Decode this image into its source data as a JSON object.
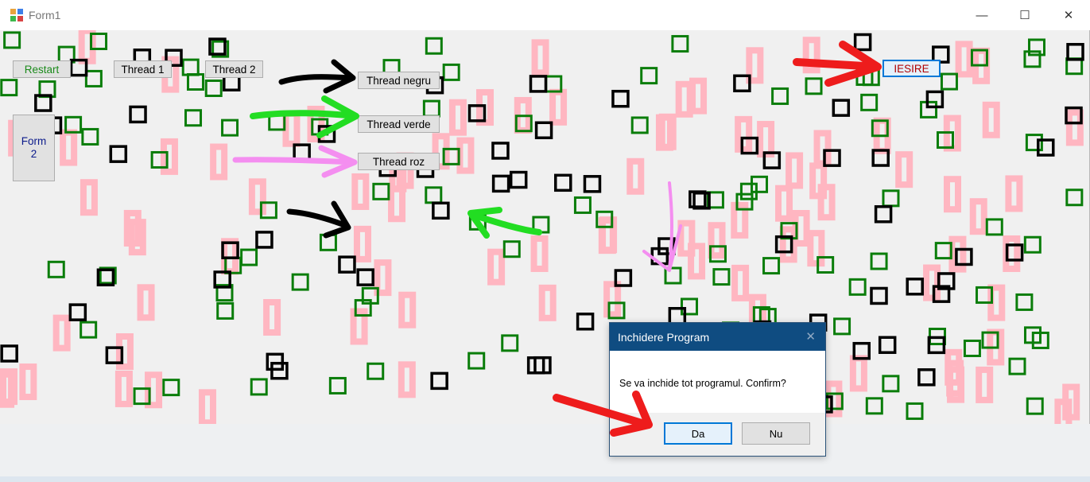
{
  "window": {
    "title": "Form1",
    "icon": "winforms-app-icon"
  },
  "titlebar_buttons": {
    "minimize": "—",
    "maximize": "☐",
    "close": "✕"
  },
  "buttons": {
    "restart": "Restart",
    "thread1": "Thread 1",
    "thread2": "Thread 2",
    "thread_negru": "Thread negru",
    "thread_verde": "Thread verde",
    "thread_roz": "Thread roz",
    "form2_line1": "Form",
    "form2_line2": "2",
    "iesire": "IESIRE"
  },
  "dialog": {
    "title": "Inchidere Program",
    "message": "Se va inchide tot programul. Confirm?",
    "yes": "Da",
    "no": "Nu"
  },
  "colors": {
    "black_square": "#000000",
    "green_square": "#0a7d0a",
    "pink_rect": "#ffb6c1",
    "arrow_black": "#000000",
    "arrow_green": "#22dd22",
    "arrow_pink": "#f48ef0",
    "arrow_red": "#ee1c1c"
  }
}
